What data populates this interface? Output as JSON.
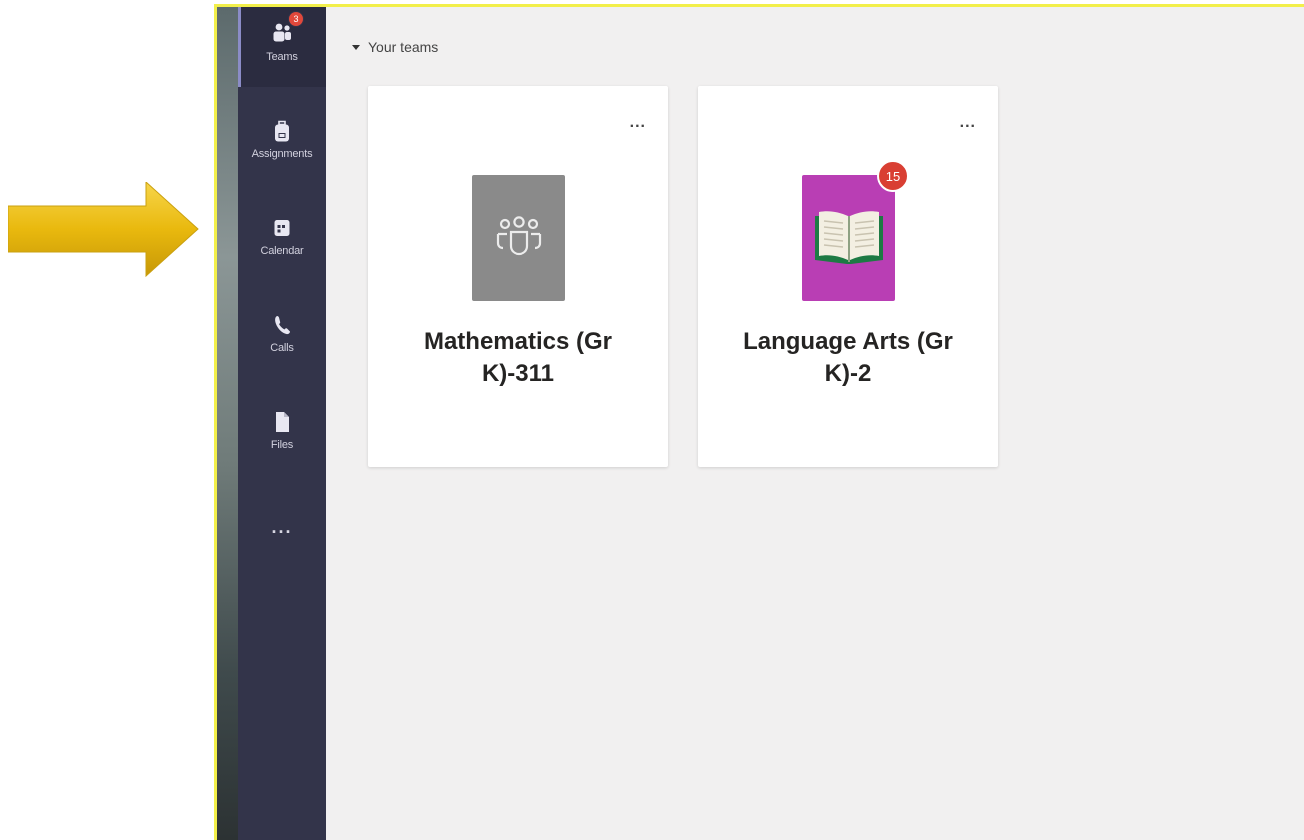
{
  "rail": {
    "items": [
      {
        "label": "Teams",
        "icon": "teams-icon",
        "badge": "3",
        "active": true
      },
      {
        "label": "Assignments",
        "icon": "backpack-icon"
      },
      {
        "label": "Calendar",
        "icon": "calendar-icon"
      },
      {
        "label": "Calls",
        "icon": "phone-icon"
      },
      {
        "label": "Files",
        "icon": "file-icon"
      }
    ],
    "more": "..."
  },
  "main": {
    "section_title": "Your teams",
    "teams": [
      {
        "name": "Mathematics (Gr K)-311",
        "more": "...",
        "avatar": "people-icon",
        "avatar_color": "#8a8a8a"
      },
      {
        "name": "Language Arts (Gr K)-2",
        "more": "...",
        "avatar": "book-icon",
        "avatar_color": "#b93eb4",
        "badge": "15"
      }
    ]
  },
  "colors": {
    "highlight_border": "#f2ef4a",
    "rail_bg": "#33344a",
    "content_bg": "#f1f0f0",
    "badge": "#d93f33",
    "arrow": "#e7b80f"
  }
}
